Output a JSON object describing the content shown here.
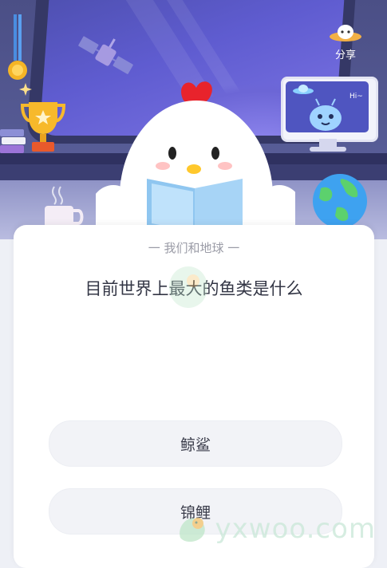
{
  "header": {
    "share_label": "分享"
  },
  "card": {
    "category": "一 我们和地球 一",
    "question": "目前世界上最大的鱼类是什么",
    "options": [
      {
        "label": "鲸鲨"
      },
      {
        "label": "锦鲤"
      }
    ]
  },
  "monitor": {
    "greeting": "Hi~"
  },
  "watermark": {
    "text": "yxwoo.com"
  },
  "colors": {
    "scene_bg": "#4b4f86",
    "card_bg": "#ffffff",
    "option_bg": "#f2f3f7",
    "question_text": "#333645",
    "category_text": "#9a9ba6"
  }
}
